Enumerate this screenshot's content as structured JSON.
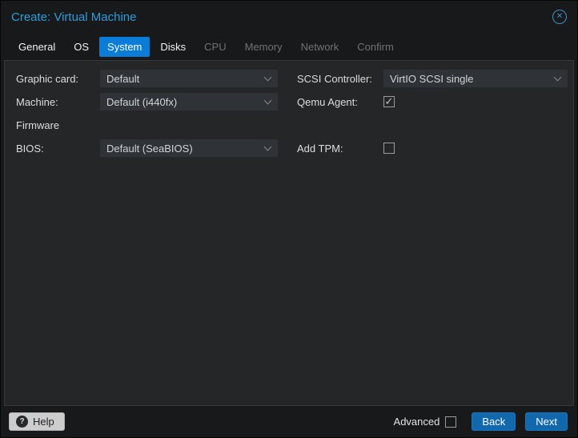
{
  "window": {
    "title": "Create: Virtual Machine"
  },
  "icons": {
    "close": "circled-x",
    "help": "question-circle",
    "select": "chevron-down"
  },
  "tabs": [
    {
      "label": "General",
      "state": "enabled"
    },
    {
      "label": "OS",
      "state": "enabled"
    },
    {
      "label": "System",
      "state": "active"
    },
    {
      "label": "Disks",
      "state": "enabled"
    },
    {
      "label": "CPU",
      "state": "disabled"
    },
    {
      "label": "Memory",
      "state": "disabled"
    },
    {
      "label": "Network",
      "state": "disabled"
    },
    {
      "label": "Confirm",
      "state": "disabled"
    }
  ],
  "form": {
    "left": [
      {
        "label": "Graphic card:",
        "type": "select",
        "value": "Default"
      },
      {
        "label": "Machine:",
        "type": "select",
        "value": "Default (i440fx)"
      },
      {
        "label": "Firmware",
        "type": "section"
      },
      {
        "label": "BIOS:",
        "type": "select",
        "value": "Default (SeaBIOS)"
      }
    ],
    "right": [
      {
        "label": "SCSI Controller:",
        "type": "select",
        "value": "VirtIO SCSI single"
      },
      {
        "label": "Qemu Agent:",
        "type": "checkbox",
        "checked": true
      },
      {
        "label": "Add TPM:",
        "type": "checkbox",
        "checked": false
      }
    ]
  },
  "footer": {
    "help": "Help",
    "advanced": "Advanced",
    "advanced_checked": false,
    "back": "Back",
    "next": "Next"
  },
  "colors": {
    "active_tab_blue": "#0b7cd8",
    "title_blue": "#2b9ddb",
    "button_blue": "#1268ad",
    "panel_bg": "#242628",
    "window_bg": "#18191b",
    "field_bg": "#2f3236"
  }
}
